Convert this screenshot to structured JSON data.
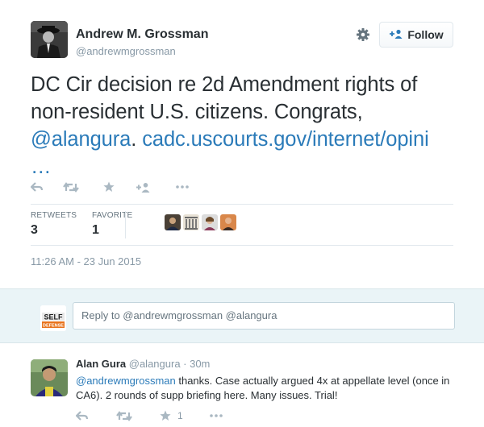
{
  "author": {
    "name": "Andrew M. Grossman",
    "handle": "@andrewmgrossman"
  },
  "follow_button": {
    "label": "Follow"
  },
  "tweet": {
    "text_1": "DC Cir decision re 2d Amendment rights of non-resident U.S. citizens. Congrats, ",
    "mention": "@alangura",
    "text_2": ". ",
    "link": "cadc.uscourts.gov/internet/opini",
    "ellipsis": "…"
  },
  "stats": {
    "retweets_label": "RETWEETS",
    "retweets_value": "3",
    "favorites_label": "FAVORITE",
    "favorites_value": "1"
  },
  "timestamp": "11:26 AM - 23 Jun 2015",
  "reply_box": {
    "placeholder": "Reply to @andrewmgrossman @alangura",
    "avatar_text_1": "SELF",
    "avatar_text_2": "DEFENSE"
  },
  "reply": {
    "name": "Alan Gura",
    "meta": "@alangura · 30m",
    "mention": "@andrewmgrossman",
    "text": " thanks. Case actually argued 4x at appellate level (once in CA6). 2 rounds of supp briefing here. Many issues. Trial!",
    "favorite_count": "1"
  },
  "colors": {
    "link": "#2b7bb9",
    "muted": "#8899a6",
    "reply_band": "#eaf4f7",
    "icon": "#aab8c2"
  },
  "icons": {
    "reply": "reply-arrow-icon",
    "retweet": "retweet-icon",
    "favorite": "star-icon",
    "follow": "add-user-icon",
    "more": "more-dots-icon",
    "settings": "gear-icon"
  }
}
